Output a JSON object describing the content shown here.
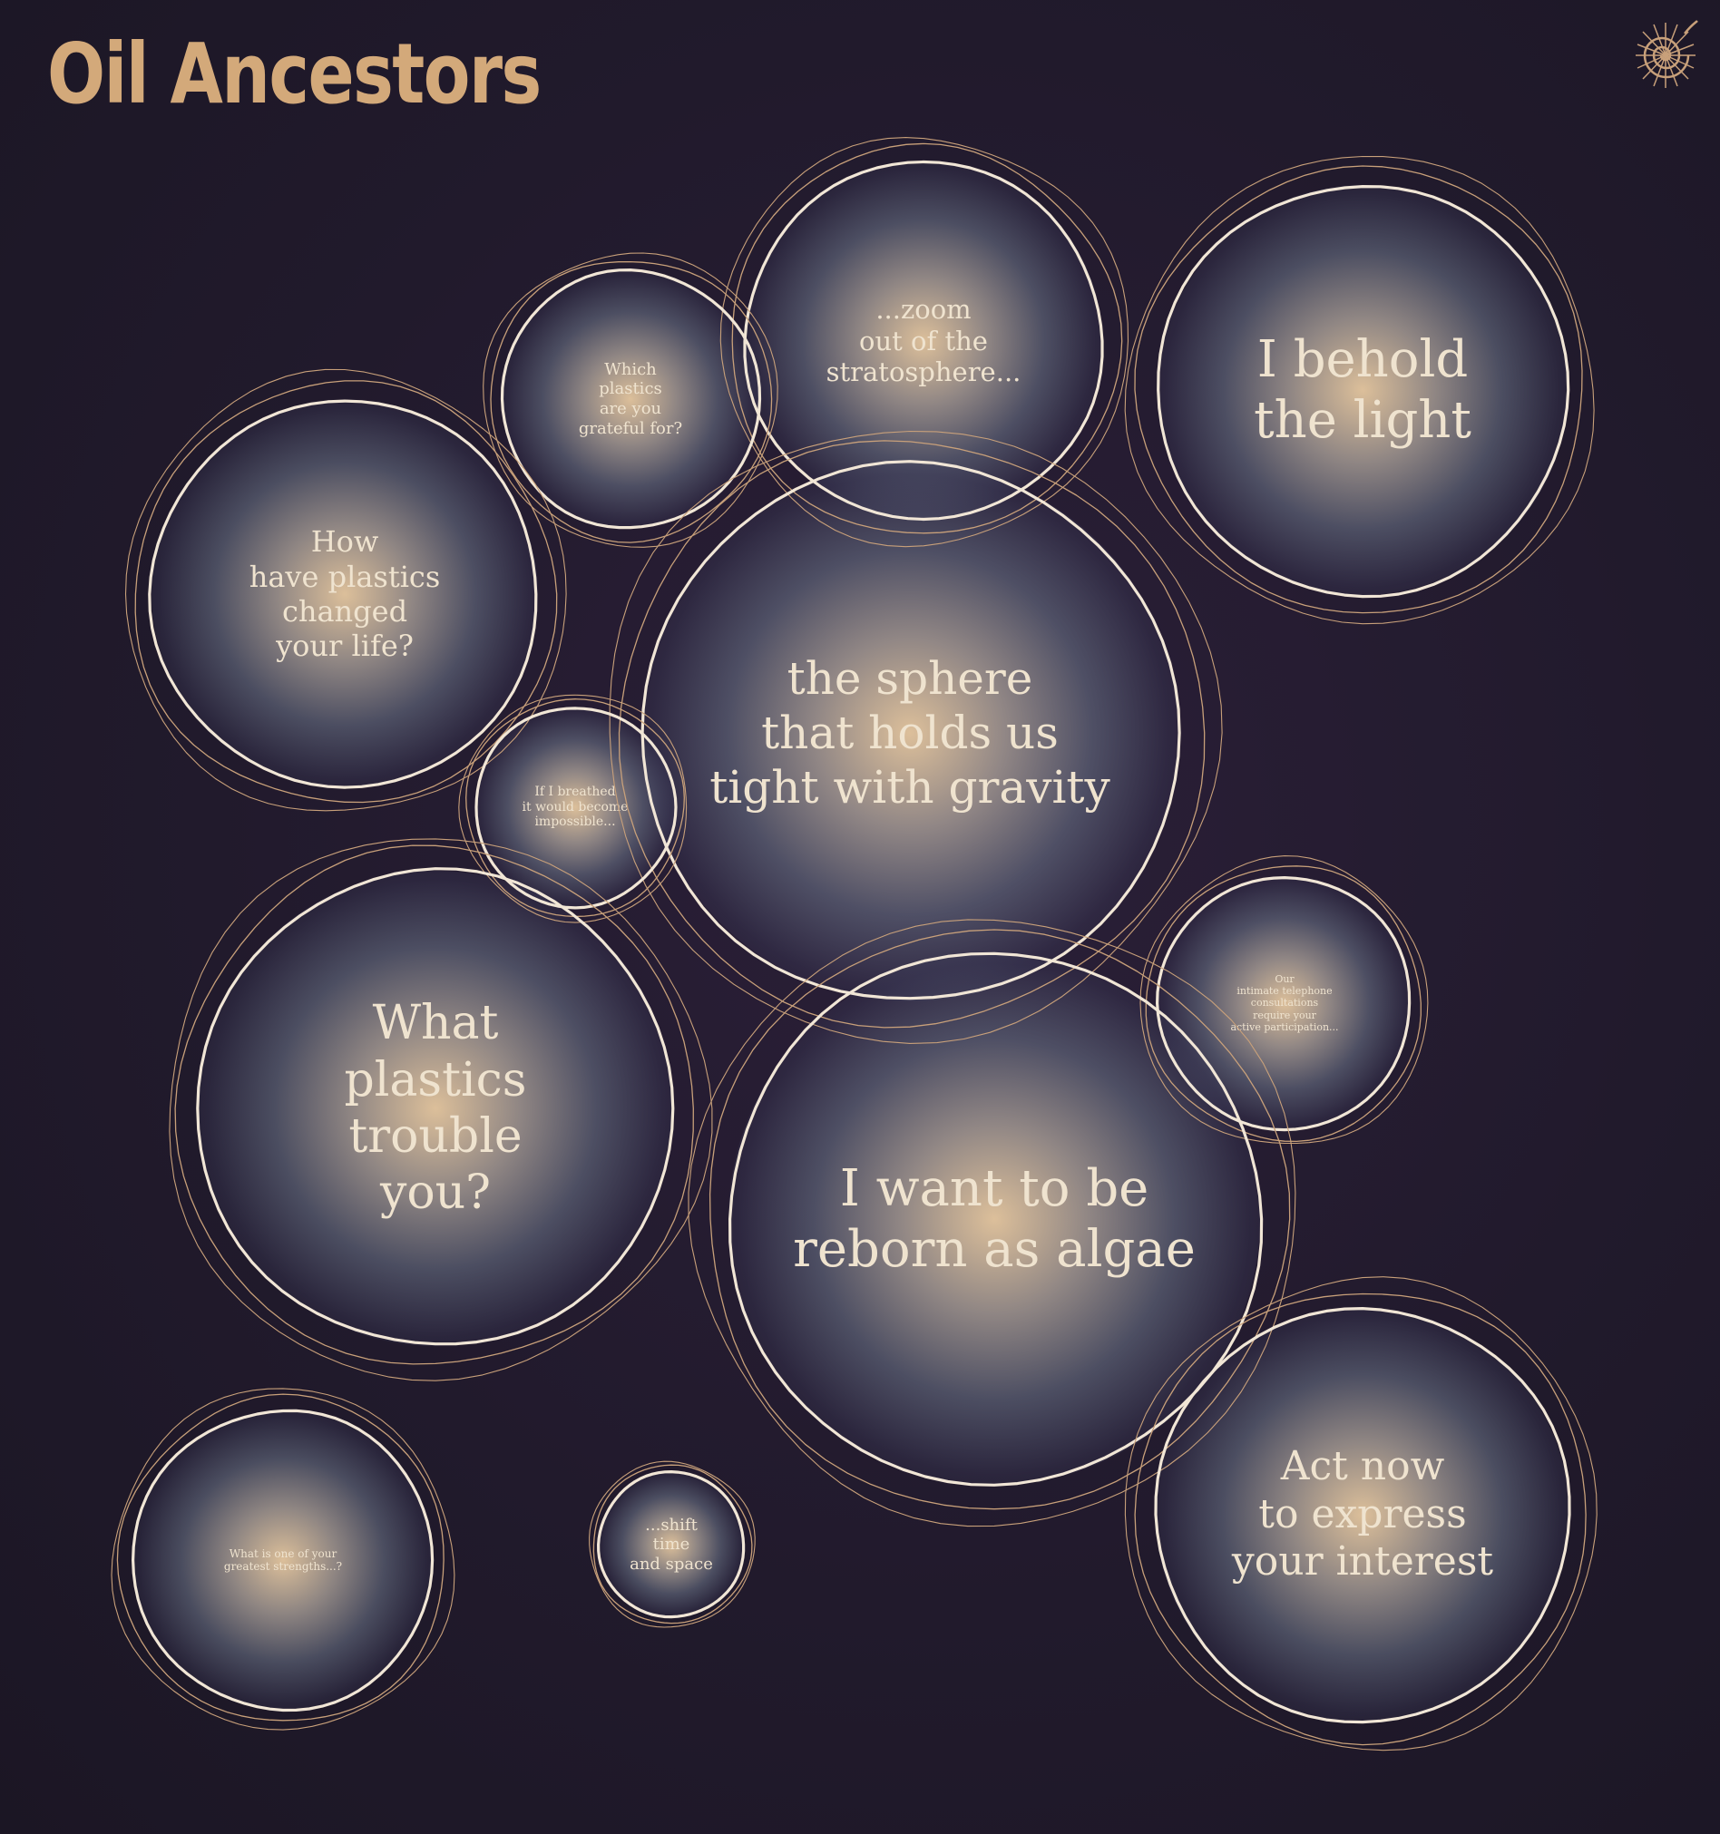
{
  "title": "Oil Ancestors",
  "logo_icon": "ammonite-shell-icon",
  "colors": {
    "background": "#221a2e",
    "title": "#d3a97a",
    "ring_outer": "#c8a07a",
    "ring_inner": "#f1e6d6",
    "text": "#efe3cf",
    "glow_center": "#e6c8a0"
  },
  "bubbles": [
    {
      "id": "zoom-out",
      "text": "...zoom\nout of the\nstratosphere..."
    },
    {
      "id": "which-plastics",
      "text": "Which\nplastics\nare you\ngrateful for?"
    },
    {
      "id": "behold-light",
      "text": "I behold\nthe light"
    },
    {
      "id": "how-plastics",
      "text": "How\nhave plastics\nchanged\nyour life?"
    },
    {
      "id": "sphere-gravity",
      "text": "the sphere\nthat holds us\ntight with gravity"
    },
    {
      "id": "if-breathed",
      "text": "If I breathed\nit would become\nimpossible..."
    },
    {
      "id": "telephone",
      "text": "Our\nintimate telephone\nconsultations\nrequire your\nactive participation..."
    },
    {
      "id": "what-trouble",
      "text": "What\nplastics\ntrouble\nyou?"
    },
    {
      "id": "reborn-algae",
      "text": "I want to be\nreborn as algae"
    },
    {
      "id": "act-now",
      "text": "Act now\nto express\nyour interest"
    },
    {
      "id": "strengths",
      "text": "What is one of your\ngreatest strengths...?"
    },
    {
      "id": "shift-time",
      "text": "...shift\ntime\nand space"
    }
  ]
}
